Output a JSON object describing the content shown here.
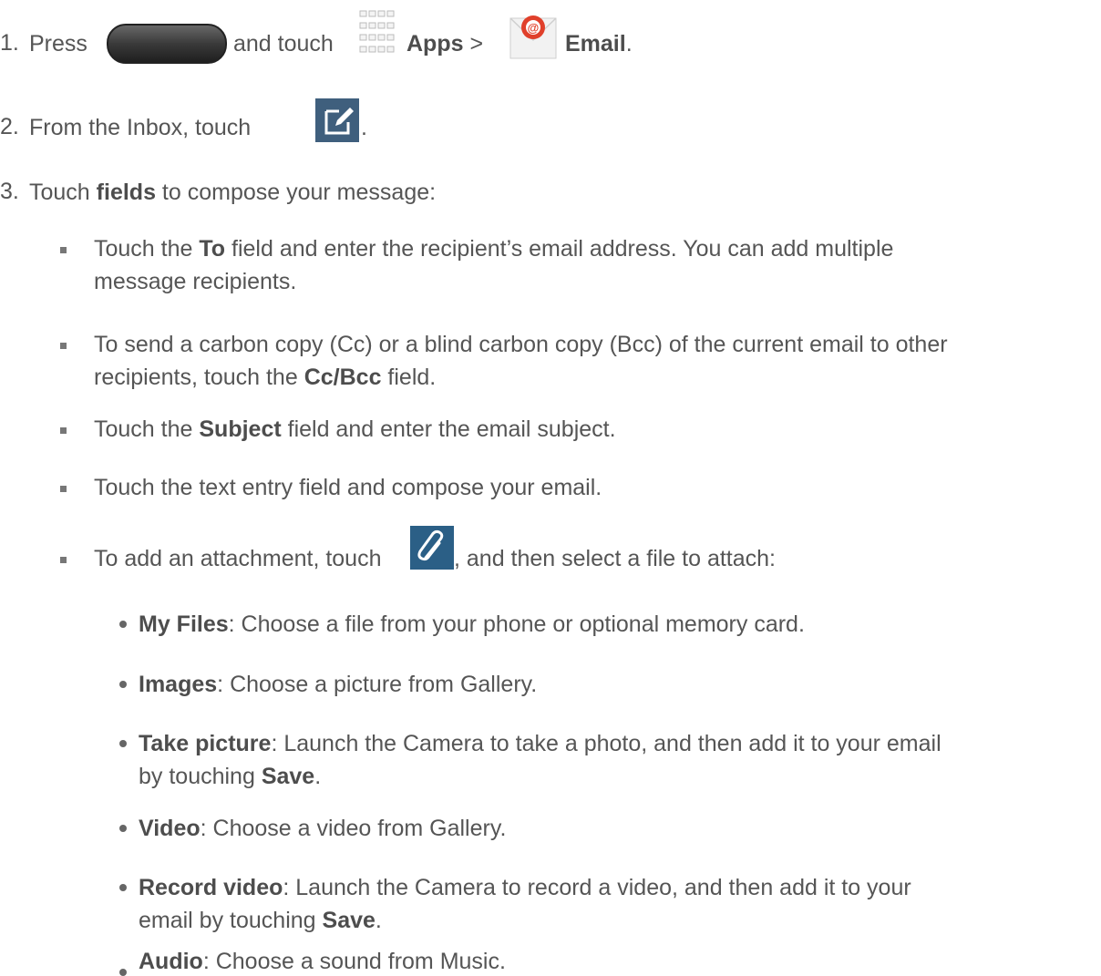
{
  "steps": [
    {
      "num": "1.",
      "t1": "Press",
      "t2": "and touch",
      "apps": "Apps",
      "gt": ">",
      "email": "Email",
      "end": "."
    },
    {
      "num": "2.",
      "t1": "From the Inbox, touch",
      "end": "."
    },
    {
      "num": "3.",
      "t1": "Touch",
      "b1": "fields",
      "t2": "to compose your message:"
    }
  ],
  "bullets": [
    {
      "l1a": "Touch the",
      "l1b": "To",
      "l1c": "field and enter the recipient’s email address. You can add multiple",
      "l2": "message recipients."
    },
    {
      "l1": "To send a carbon copy (Cc) or a blind carbon copy (Bcc) of the current email to other",
      "l2a": "recipients, touch the",
      "l2b": "Cc/Bcc",
      "l2c": "field."
    },
    {
      "a": "Touch the",
      "b": "Subject",
      "c": "field and enter the email subject."
    },
    {
      "a": "Touch the text entry field and compose your email."
    },
    {
      "a": "To add an attachment, touch",
      "c": ", and then select a file to attach:"
    }
  ],
  "subs": [
    {
      "b": "My Files",
      "t": ": Choose a file from your phone or optional memory card."
    },
    {
      "b": "Images",
      "t": ": Choose a picture from Gallery."
    },
    {
      "b": "Take picture",
      "t": ": Launch the Camera to take a photo, and then add it to your email",
      "l2a": "by touching",
      "l2b": "Save",
      "l2c": "."
    },
    {
      "b": "Video",
      "t": ": Choose a video from Gallery."
    },
    {
      "b": "Record video",
      "t": ": Launch the Camera to record a video, and then add it to your",
      "l2a": "email by touching",
      "l2b": "Save",
      "l2c": "."
    },
    {
      "b": "Audio",
      "t": ": Choose a sound from Music."
    }
  ],
  "icons": [
    "home-key-icon",
    "apps-grid-icon",
    "email-app-icon",
    "compose-icon",
    "paperclip-icon"
  ],
  "colors": {
    "text": "#555555",
    "compose_bg": "#3f5f7d",
    "clip_bg": "#2b5f86",
    "email_red": "#e0402b"
  }
}
